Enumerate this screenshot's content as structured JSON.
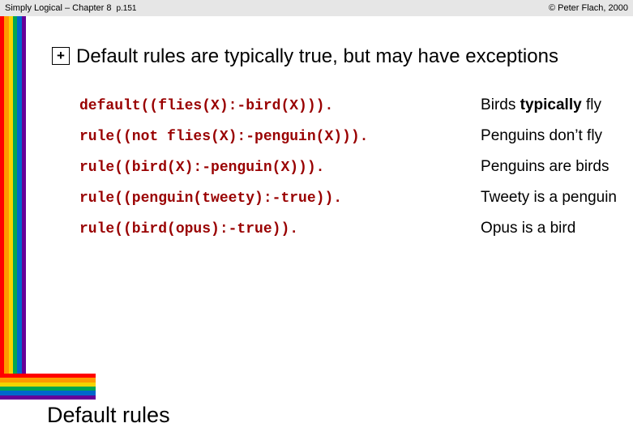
{
  "header": {
    "left": "Simply Logical – Chapter 8",
    "page": "p.151",
    "right": "© Peter Flach, 2000"
  },
  "bullet_glyph": "+",
  "heading": "Default rules are typically true, but may have exceptions",
  "rules": [
    {
      "code": "default((flies(X):-bird(X))).",
      "desc_pre": "Birds ",
      "desc_b": "typically",
      "desc_post": "  fly"
    },
    {
      "code": "rule((not flies(X):-penguin(X))).",
      "desc_pre": "Penguins don’t fly",
      "desc_b": "",
      "desc_post": ""
    },
    {
      "code": "rule((bird(X):-penguin(X))).",
      "desc_pre": "Penguins are birds",
      "desc_b": "",
      "desc_post": ""
    },
    {
      "code": "rule((penguin(tweety):-true)).",
      "desc_pre": "Tweety is a penguin",
      "desc_b": "",
      "desc_post": ""
    },
    {
      "code": "rule((bird(opus):-true)).",
      "desc_pre": "Opus is a bird",
      "desc_b": "",
      "desc_post": ""
    }
  ],
  "slide_title": "Default rules",
  "colors": [
    "c-red",
    "c-orange",
    "c-yellow",
    "c-green",
    "c-blue",
    "c-purple"
  ]
}
